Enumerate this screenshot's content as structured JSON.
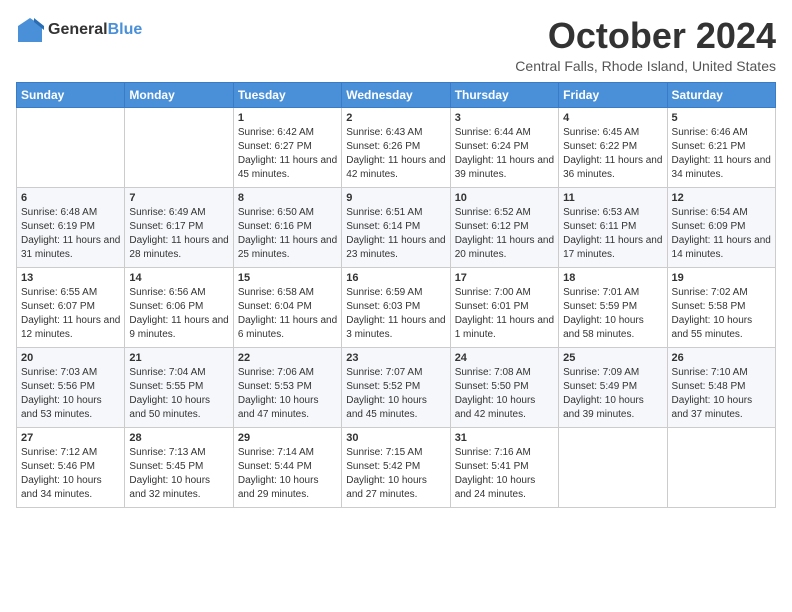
{
  "logo": {
    "general": "General",
    "blue": "Blue"
  },
  "title": "October 2024",
  "subtitle": "Central Falls, Rhode Island, United States",
  "days_of_week": [
    "Sunday",
    "Monday",
    "Tuesday",
    "Wednesday",
    "Thursday",
    "Friday",
    "Saturday"
  ],
  "weeks": [
    [
      {
        "day": "",
        "info": ""
      },
      {
        "day": "",
        "info": ""
      },
      {
        "day": "1",
        "info": "Sunrise: 6:42 AM\nSunset: 6:27 PM\nDaylight: 11 hours and 45 minutes."
      },
      {
        "day": "2",
        "info": "Sunrise: 6:43 AM\nSunset: 6:26 PM\nDaylight: 11 hours and 42 minutes."
      },
      {
        "day": "3",
        "info": "Sunrise: 6:44 AM\nSunset: 6:24 PM\nDaylight: 11 hours and 39 minutes."
      },
      {
        "day": "4",
        "info": "Sunrise: 6:45 AM\nSunset: 6:22 PM\nDaylight: 11 hours and 36 minutes."
      },
      {
        "day": "5",
        "info": "Sunrise: 6:46 AM\nSunset: 6:21 PM\nDaylight: 11 hours and 34 minutes."
      }
    ],
    [
      {
        "day": "6",
        "info": "Sunrise: 6:48 AM\nSunset: 6:19 PM\nDaylight: 11 hours and 31 minutes."
      },
      {
        "day": "7",
        "info": "Sunrise: 6:49 AM\nSunset: 6:17 PM\nDaylight: 11 hours and 28 minutes."
      },
      {
        "day": "8",
        "info": "Sunrise: 6:50 AM\nSunset: 6:16 PM\nDaylight: 11 hours and 25 minutes."
      },
      {
        "day": "9",
        "info": "Sunrise: 6:51 AM\nSunset: 6:14 PM\nDaylight: 11 hours and 23 minutes."
      },
      {
        "day": "10",
        "info": "Sunrise: 6:52 AM\nSunset: 6:12 PM\nDaylight: 11 hours and 20 minutes."
      },
      {
        "day": "11",
        "info": "Sunrise: 6:53 AM\nSunset: 6:11 PM\nDaylight: 11 hours and 17 minutes."
      },
      {
        "day": "12",
        "info": "Sunrise: 6:54 AM\nSunset: 6:09 PM\nDaylight: 11 hours and 14 minutes."
      }
    ],
    [
      {
        "day": "13",
        "info": "Sunrise: 6:55 AM\nSunset: 6:07 PM\nDaylight: 11 hours and 12 minutes."
      },
      {
        "day": "14",
        "info": "Sunrise: 6:56 AM\nSunset: 6:06 PM\nDaylight: 11 hours and 9 minutes."
      },
      {
        "day": "15",
        "info": "Sunrise: 6:58 AM\nSunset: 6:04 PM\nDaylight: 11 hours and 6 minutes."
      },
      {
        "day": "16",
        "info": "Sunrise: 6:59 AM\nSunset: 6:03 PM\nDaylight: 11 hours and 3 minutes."
      },
      {
        "day": "17",
        "info": "Sunrise: 7:00 AM\nSunset: 6:01 PM\nDaylight: 11 hours and 1 minute."
      },
      {
        "day": "18",
        "info": "Sunrise: 7:01 AM\nSunset: 5:59 PM\nDaylight: 10 hours and 58 minutes."
      },
      {
        "day": "19",
        "info": "Sunrise: 7:02 AM\nSunset: 5:58 PM\nDaylight: 10 hours and 55 minutes."
      }
    ],
    [
      {
        "day": "20",
        "info": "Sunrise: 7:03 AM\nSunset: 5:56 PM\nDaylight: 10 hours and 53 minutes."
      },
      {
        "day": "21",
        "info": "Sunrise: 7:04 AM\nSunset: 5:55 PM\nDaylight: 10 hours and 50 minutes."
      },
      {
        "day": "22",
        "info": "Sunrise: 7:06 AM\nSunset: 5:53 PM\nDaylight: 10 hours and 47 minutes."
      },
      {
        "day": "23",
        "info": "Sunrise: 7:07 AM\nSunset: 5:52 PM\nDaylight: 10 hours and 45 minutes."
      },
      {
        "day": "24",
        "info": "Sunrise: 7:08 AM\nSunset: 5:50 PM\nDaylight: 10 hours and 42 minutes."
      },
      {
        "day": "25",
        "info": "Sunrise: 7:09 AM\nSunset: 5:49 PM\nDaylight: 10 hours and 39 minutes."
      },
      {
        "day": "26",
        "info": "Sunrise: 7:10 AM\nSunset: 5:48 PM\nDaylight: 10 hours and 37 minutes."
      }
    ],
    [
      {
        "day": "27",
        "info": "Sunrise: 7:12 AM\nSunset: 5:46 PM\nDaylight: 10 hours and 34 minutes."
      },
      {
        "day": "28",
        "info": "Sunrise: 7:13 AM\nSunset: 5:45 PM\nDaylight: 10 hours and 32 minutes."
      },
      {
        "day": "29",
        "info": "Sunrise: 7:14 AM\nSunset: 5:44 PM\nDaylight: 10 hours and 29 minutes."
      },
      {
        "day": "30",
        "info": "Sunrise: 7:15 AM\nSunset: 5:42 PM\nDaylight: 10 hours and 27 minutes."
      },
      {
        "day": "31",
        "info": "Sunrise: 7:16 AM\nSunset: 5:41 PM\nDaylight: 10 hours and 24 minutes."
      },
      {
        "day": "",
        "info": ""
      },
      {
        "day": "",
        "info": ""
      }
    ]
  ]
}
